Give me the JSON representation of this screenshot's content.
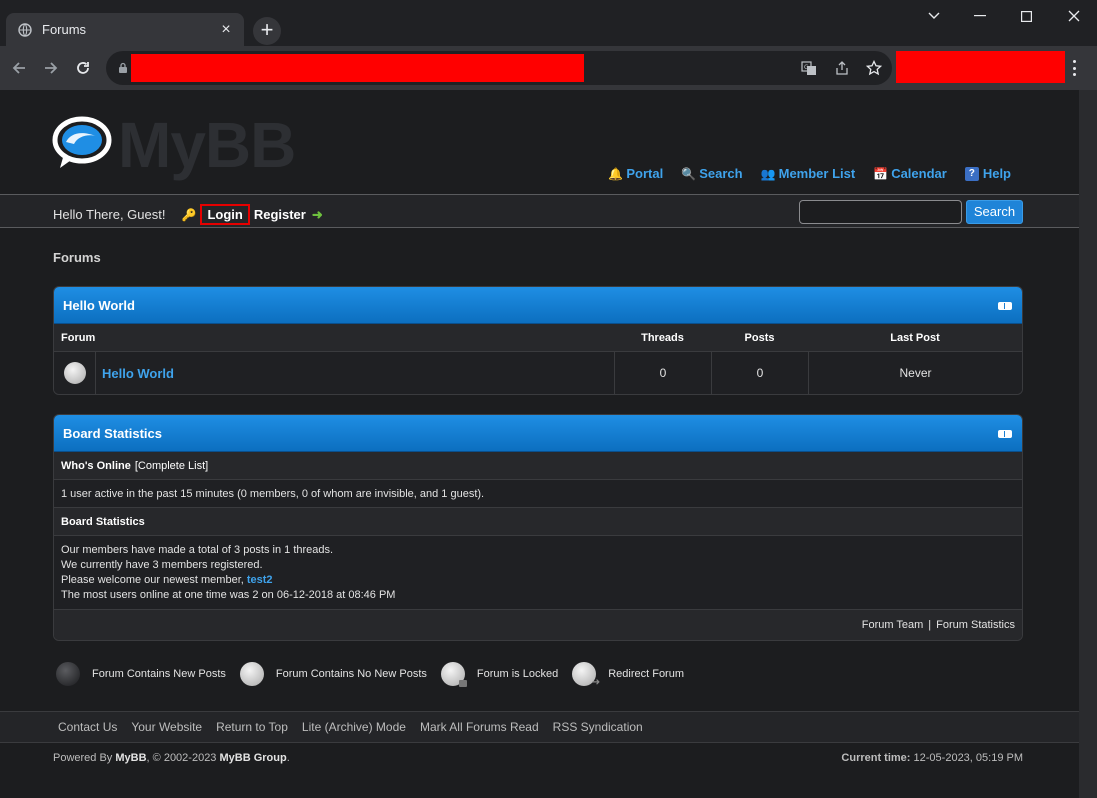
{
  "browser": {
    "tab_title": "Forums",
    "new_tab": "+",
    "close_tab": "×"
  },
  "site": {
    "logo_text": "MyBB",
    "nav": [
      {
        "label": "Portal",
        "icon": "bell-icon"
      },
      {
        "label": "Search",
        "icon": "magnifier-icon"
      },
      {
        "label": "Member List",
        "icon": "members-icon"
      },
      {
        "label": "Calendar",
        "icon": "calendar-icon"
      },
      {
        "label": "Help",
        "icon": "help-icon"
      }
    ],
    "welcome": "Hello There, Guest!",
    "login": "Login",
    "register": "Register",
    "search_button": "Search",
    "search_value": ""
  },
  "breadcrumb": "Forums",
  "forum_table": {
    "title": "Hello World",
    "columns": {
      "forum": "Forum",
      "threads": "Threads",
      "posts": "Posts",
      "last_post": "Last Post"
    },
    "rows": [
      {
        "name": "Hello World",
        "threads": "0",
        "posts": "0",
        "last_post": "Never"
      }
    ]
  },
  "stats": {
    "title": "Board Statistics",
    "whos_online": "Who's Online",
    "complete_list": "[Complete List]",
    "online_text": "1 user active in the past 15 minutes (0 members, 0 of whom are invisible, and 1 guest).",
    "board_stats_heading": "Board Statistics",
    "line1": "Our members have made a total of 3 posts in 1 threads.",
    "line2": "We currently have 3 members registered.",
    "line3_prefix": "Please welcome our newest member,",
    "newest_member": "test2",
    "line4": "The most users online at one time was 2 on 06-12-2018 at 08:46 PM",
    "forum_team": "Forum Team",
    "separator": "|",
    "forum_statistics": "Forum Statistics"
  },
  "legend": [
    {
      "label": "Forum Contains New Posts",
      "kind": "new"
    },
    {
      "label": "Forum Contains No New Posts",
      "kind": "nonew"
    },
    {
      "label": "Forum is Locked",
      "kind": "locked"
    },
    {
      "label": "Redirect Forum",
      "kind": "redirect"
    }
  ],
  "footer": {
    "links": [
      "Contact Us",
      "Your Website",
      "Return to Top",
      "Lite (Archive) Mode",
      "Mark All Forums Read",
      "RSS Syndication"
    ],
    "powered_by": "Powered By",
    "mybb": "MyBB",
    "copyright": ", © 2002-2023",
    "mybb_group": "MyBB Group",
    "period": ".",
    "current_time_label": "Current time:",
    "current_time": "12-05-2023, 05:19 PM"
  }
}
